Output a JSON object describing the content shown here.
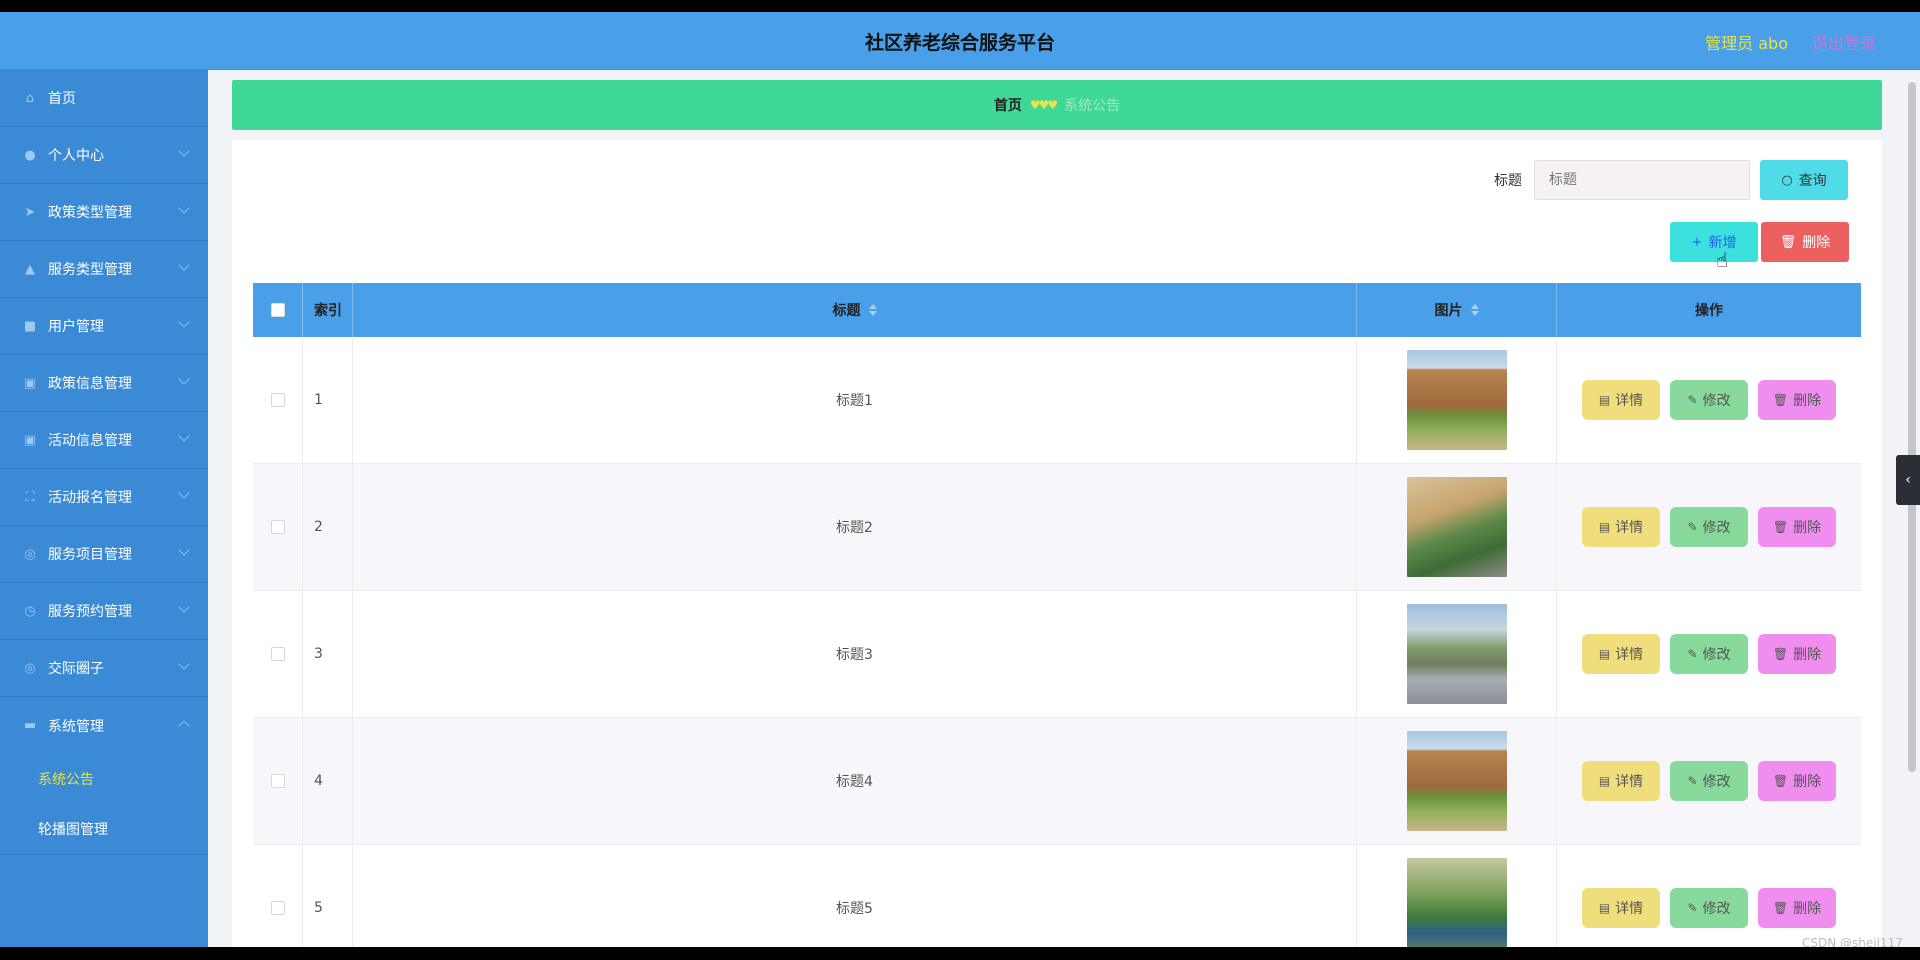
{
  "header": {
    "title": "社区养老综合服务平台",
    "admin_label": "管理员 abo",
    "logout_label": "退出登录"
  },
  "sidebar": {
    "items": [
      {
        "label": "首页",
        "icon": "home-icon"
      },
      {
        "label": "个人中心",
        "icon": "user-icon"
      },
      {
        "label": "政策类型管理",
        "icon": "send-icon"
      },
      {
        "label": "服务类型管理",
        "icon": "thumbs-up-icon"
      },
      {
        "label": "用户管理",
        "icon": "briefcase-icon"
      },
      {
        "label": "政策信息管理",
        "icon": "clipboard-icon"
      },
      {
        "label": "活动信息管理",
        "icon": "clipboard-icon"
      },
      {
        "label": "活动报名管理",
        "icon": "fullscreen-icon"
      },
      {
        "label": "服务项目管理",
        "icon": "compass-icon"
      },
      {
        "label": "服务预约管理",
        "icon": "clock-icon"
      },
      {
        "label": "交际圈子",
        "icon": "compass-icon"
      },
      {
        "label": "系统管理",
        "icon": "ticket-icon"
      }
    ],
    "submenu": [
      {
        "label": "系统公告",
        "active": true
      },
      {
        "label": "轮播图管理",
        "active": false
      }
    ]
  },
  "breadcrumb": {
    "home": "首页",
    "separator": "♥♥♥",
    "current": "系统公告"
  },
  "search": {
    "label": "标题",
    "placeholder": "标题",
    "query_label": "查询"
  },
  "actions": {
    "add_label": "新增",
    "delete_label": "删除"
  },
  "table": {
    "columns": [
      "索引",
      "标题",
      "图片",
      "操作"
    ],
    "rows": [
      {
        "index": "1",
        "title": "标题1"
      },
      {
        "index": "2",
        "title": "标题2"
      },
      {
        "index": "3",
        "title": "标题3"
      },
      {
        "index": "4",
        "title": "标题4"
      },
      {
        "index": "5",
        "title": "标题5"
      }
    ],
    "row_actions": {
      "detail": "详情",
      "edit": "修改",
      "delete": "删除"
    }
  },
  "watermark": "CSDN @shejl117",
  "colors": {
    "header": "#4aa0e8",
    "sidebar": "#3a8ad6",
    "breadcrumb": "#40d896",
    "detail_button": "#f0de7c",
    "edit_button": "#88d99c",
    "delete_button": "#f08ef0"
  }
}
